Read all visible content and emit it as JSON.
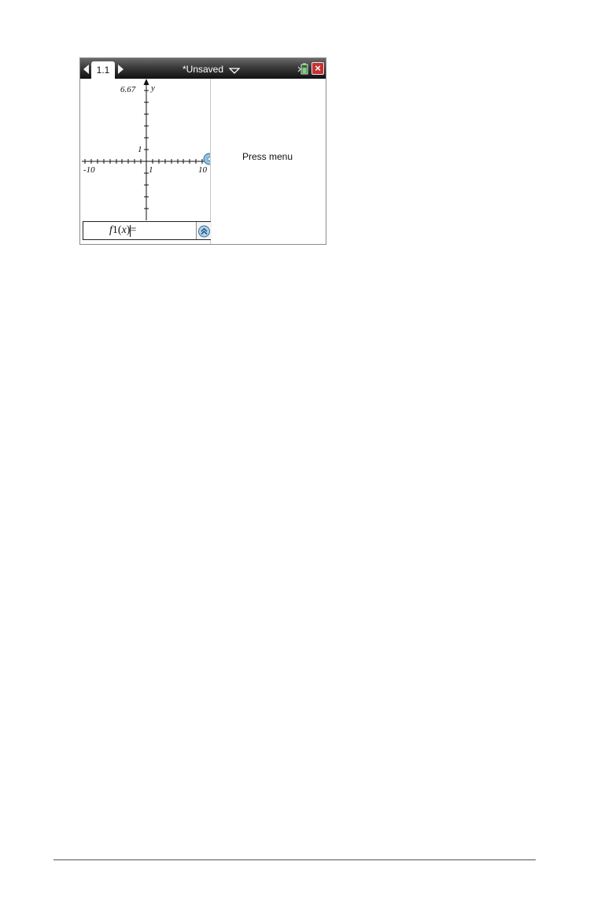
{
  "titlebar": {
    "page_tab": "1.1",
    "document_title": "*Unsaved"
  },
  "graph": {
    "ymax_label": "6.67",
    "y_axis_label": "y",
    "y_tick_label": "1",
    "xmin_label": "-10",
    "x_tick_label": "1",
    "xmax_label": "10"
  },
  "entry_line": {
    "prefix": "f",
    "index": "1",
    "open": "(",
    "var": "x",
    "close": ")=",
    "value": ""
  },
  "right_pane": {
    "hint": "Press menu"
  },
  "colors": {
    "titlebar": "#2a2a2a",
    "close_button": "#c93030",
    "pointer": "#8fc3e6"
  },
  "icons": {
    "prev_page": "triangle-left-icon",
    "next_page": "triangle-right-icon",
    "dropdown": "triangle-down-icon",
    "battery": "battery-icon",
    "close": "close-icon",
    "expand": "double-chevron-up-icon",
    "pointer": "hand-pointer-icon"
  }
}
